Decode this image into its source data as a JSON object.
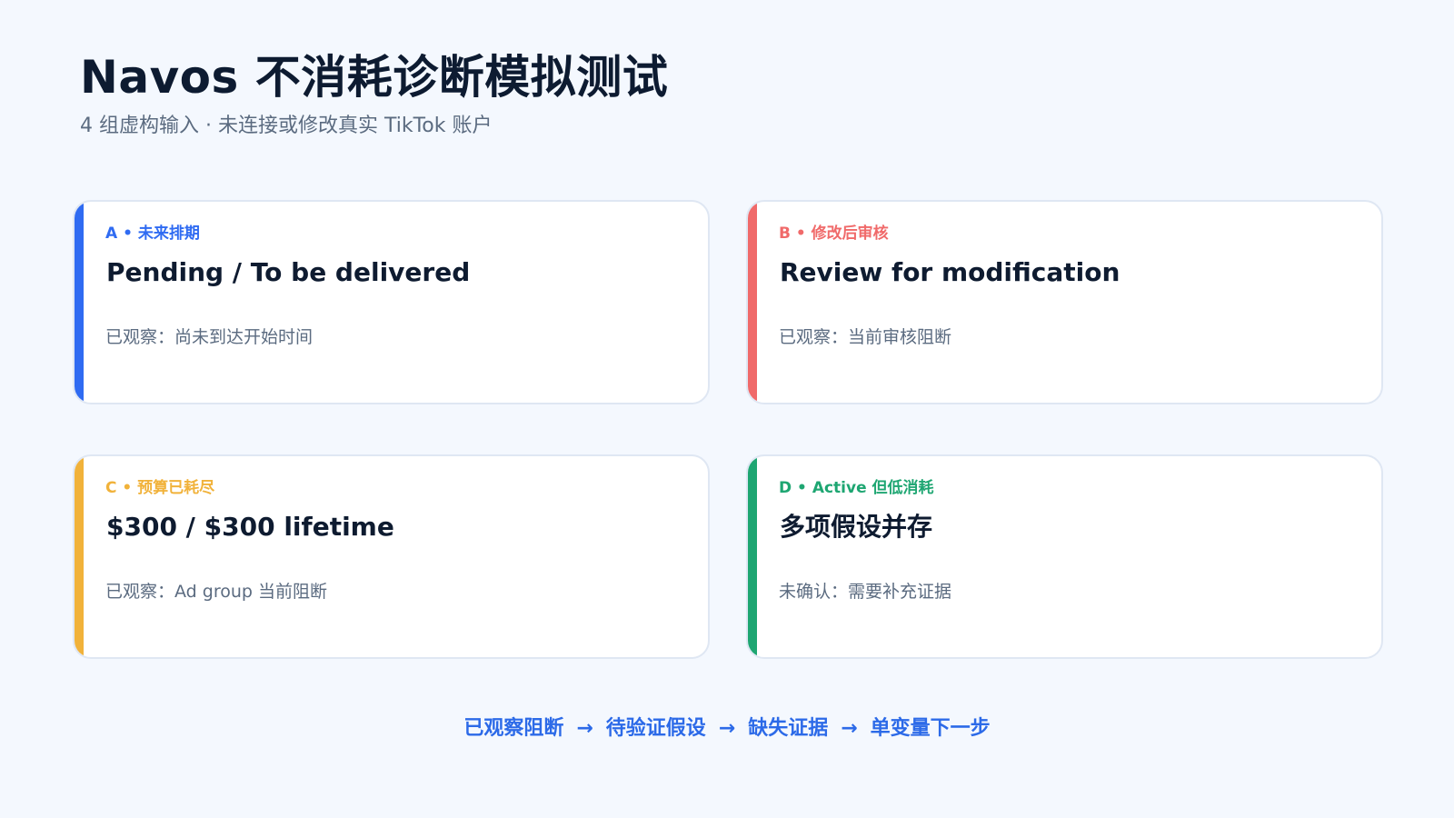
{
  "header": {
    "title": "Navos 不消耗诊断模拟测试",
    "subtitle": "4 组虚构输入 · 未连接或修改真实 TikTok 账户"
  },
  "cards": [
    {
      "eyebrow": "A • 未来排期",
      "heading": "Pending / To be delivered",
      "note": "已观察：尚未到达开始时间",
      "accent": "#2f6bf2"
    },
    {
      "eyebrow": "B • 修改后审核",
      "heading": "Review for modification",
      "note": "已观察：当前审核阻断",
      "accent": "#f06a6a"
    },
    {
      "eyebrow": "C • 预算已耗尽",
      "heading": "$300 / $300 lifetime",
      "note": "已观察：Ad group 当前阻断",
      "accent": "#f1b23a"
    },
    {
      "eyebrow": "D • Active 但低消耗",
      "heading": "多项假设并存",
      "note": "未确认：需要补充证据",
      "accent": "#1ea672"
    }
  ],
  "flow": {
    "steps": [
      "已观察阻断",
      "待验证假设",
      "缺失证据",
      "单变量下一步"
    ],
    "arrow": "→",
    "color": "#2c6ae8"
  }
}
